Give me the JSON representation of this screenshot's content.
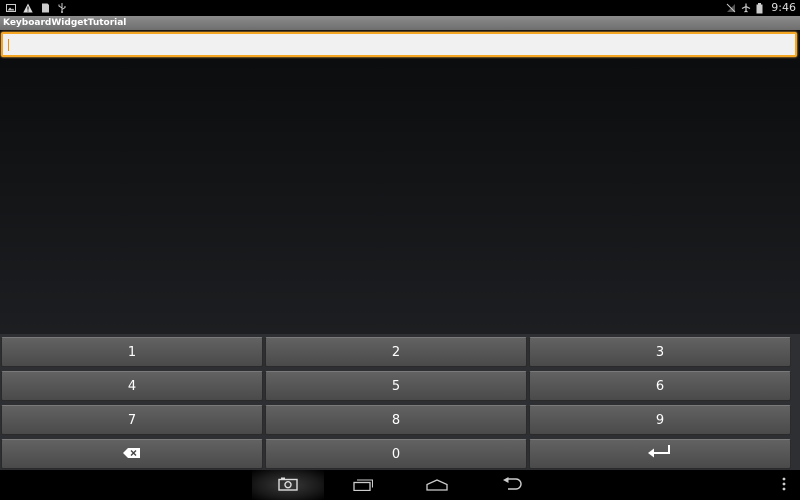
{
  "status_bar": {
    "left_icons": [
      "image-icon",
      "warning-icon",
      "sd-card-icon",
      "usb-icon"
    ],
    "right_icons": [
      "no-signal-icon",
      "airplane-mode-icon",
      "battery-icon"
    ],
    "time": "9:46"
  },
  "app": {
    "title": "KeyboardWidgetTutorial"
  },
  "input": {
    "value": "",
    "placeholder": ""
  },
  "keyboard": {
    "rows": [
      [
        "1",
        "2",
        "3"
      ],
      [
        "4",
        "5",
        "6"
      ],
      [
        "7",
        "8",
        "9"
      ],
      [
        "backspace-icon",
        "0",
        "enter-icon"
      ]
    ]
  },
  "nav_bar": {
    "buttons": [
      "screenshot-icon",
      "recent-apps-icon",
      "home-icon",
      "back-icon"
    ],
    "menu": "overflow-menu-icon"
  },
  "colors": {
    "focus_border": "#f5a623",
    "title_bar": "#7c7c7c",
    "key_face": "#555555"
  }
}
